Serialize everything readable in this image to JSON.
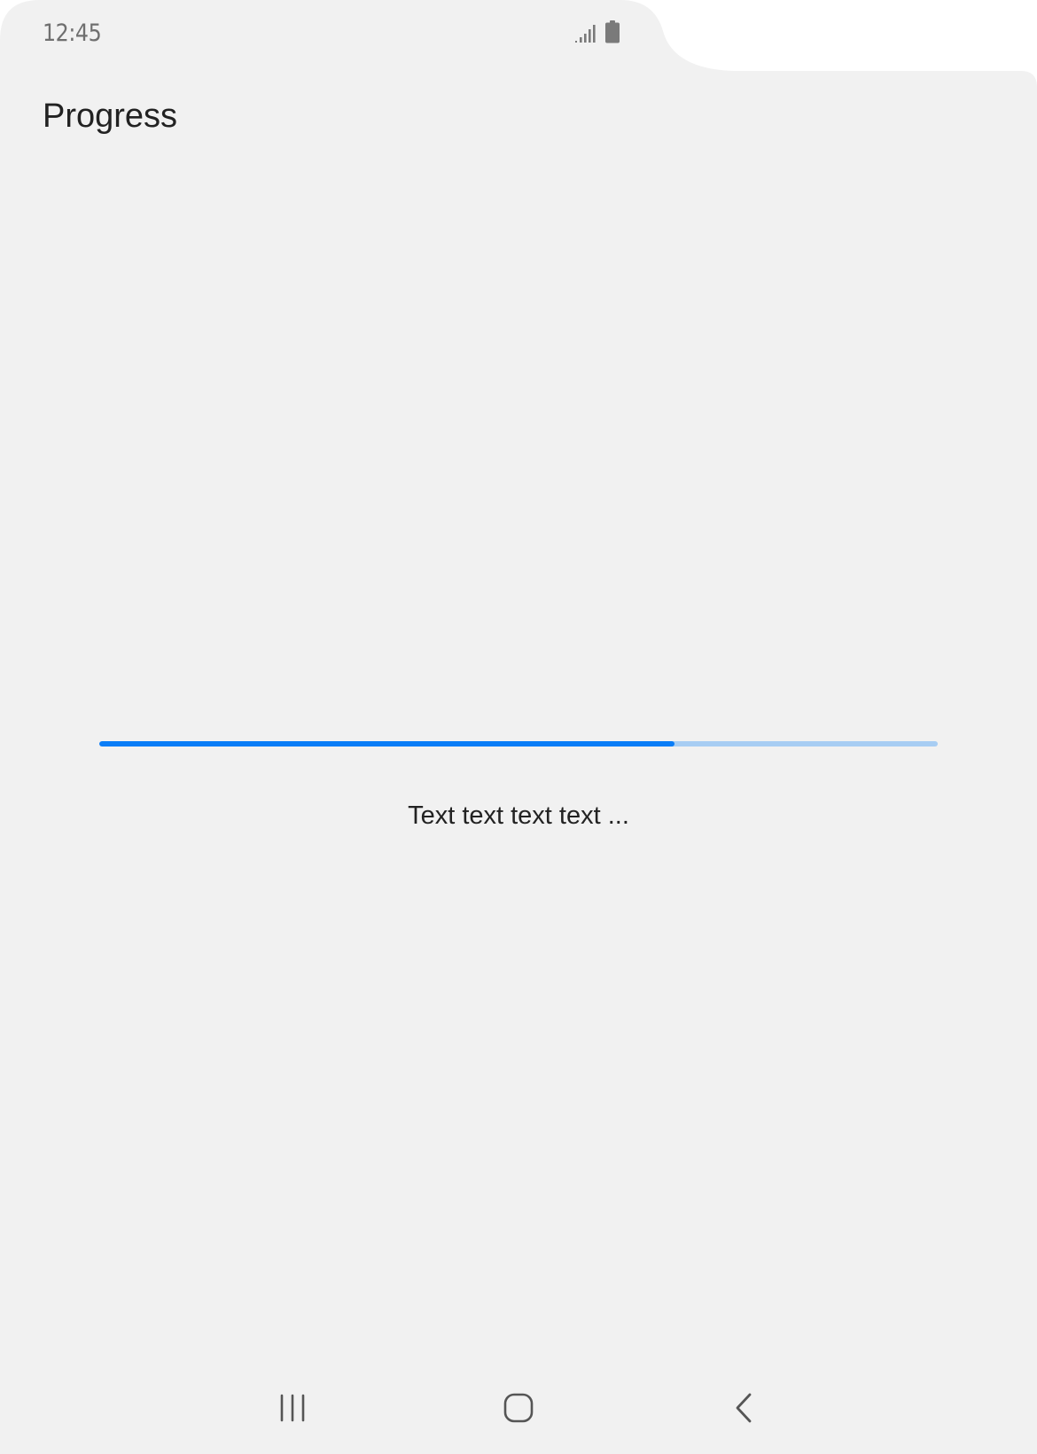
{
  "status_bar": {
    "time": "12:45",
    "icons": [
      "signal-icon",
      "battery-icon"
    ]
  },
  "header": {
    "title": "Progress"
  },
  "progress": {
    "value": 0.686,
    "text": "Text text text text ...",
    "colors": {
      "fill": "#0a7df7",
      "track": "#a7cdf3"
    }
  },
  "nav_bar": {
    "buttons": [
      "recent-apps-icon",
      "home-icon",
      "back-icon"
    ]
  },
  "colors": {
    "background": "#f1f1f1",
    "text": "#222222",
    "status_text": "#6f6f6f"
  }
}
